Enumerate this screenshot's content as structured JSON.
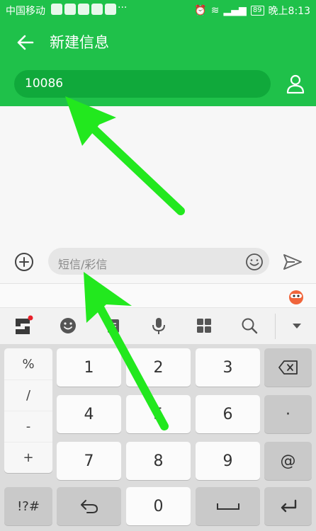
{
  "status_bar": {
    "carrier": "中国移动",
    "dots": "···",
    "battery": "89",
    "time": "晚上8:13"
  },
  "header": {
    "title": "新建信息",
    "recipient": "10086"
  },
  "compose": {
    "placeholder": "短信/彩信"
  },
  "keyboard": {
    "symbols": [
      "%",
      "/",
      "-",
      "+"
    ],
    "rows": [
      [
        "1",
        "2",
        "3"
      ],
      [
        "4",
        "5",
        "6"
      ],
      [
        "7",
        "8",
        "9"
      ]
    ],
    "dot": "·",
    "at": "@",
    "switch_label": "!?#",
    "zero": "0"
  },
  "colors": {
    "brand_green": "#1fc14a",
    "arrow_green": "#22e81e"
  }
}
